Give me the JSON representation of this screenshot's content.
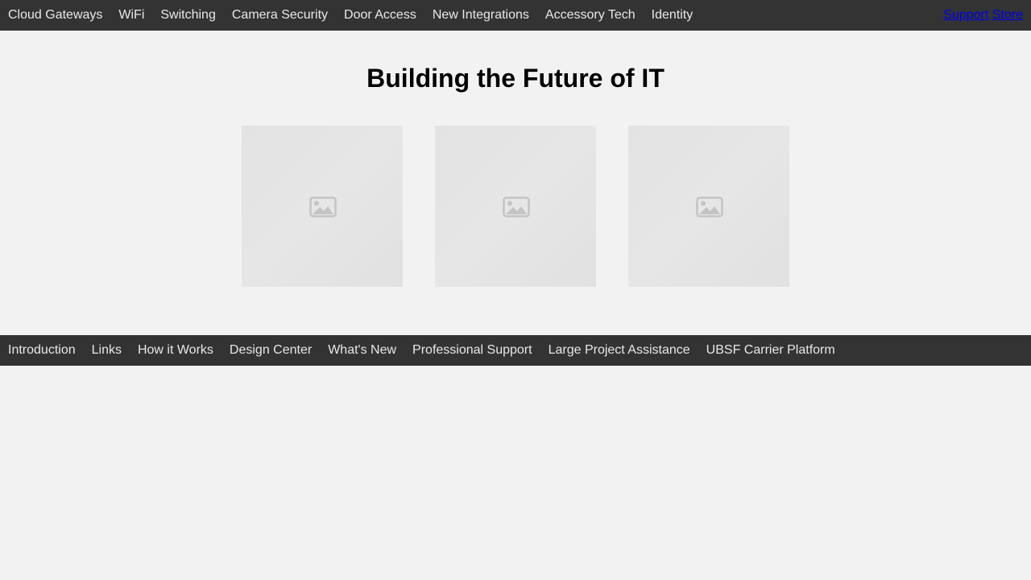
{
  "top_nav": {
    "items": [
      {
        "label": "Cloud Gateways"
      },
      {
        "label": "WiFi"
      },
      {
        "label": "Switching"
      },
      {
        "label": "Camera Security"
      },
      {
        "label": "Door Access"
      },
      {
        "label": "New Integrations"
      },
      {
        "label": "Accessory Tech"
      },
      {
        "label": "Identity"
      }
    ],
    "right_links": {
      "support": "Support",
      "store": "Store"
    }
  },
  "hero": {
    "title": "Building the Future of IT",
    "images": [
      {
        "icon": "broken-image-icon"
      },
      {
        "icon": "broken-image-icon"
      },
      {
        "icon": "broken-image-icon"
      }
    ]
  },
  "bottom_nav": {
    "items": [
      {
        "label": "Introduction"
      },
      {
        "label": "Links"
      },
      {
        "label": "How it Works"
      },
      {
        "label": "Design Center"
      },
      {
        "label": "What's New"
      },
      {
        "label": "Professional Support"
      },
      {
        "label": "Large Project Assistance"
      },
      {
        "label": "UBSF Carrier Platform"
      }
    ]
  },
  "colors": {
    "nav_background": "#333333",
    "nav_text": "#e8e8e8",
    "page_background": "#f2f2f2",
    "link": "#0000ee"
  }
}
